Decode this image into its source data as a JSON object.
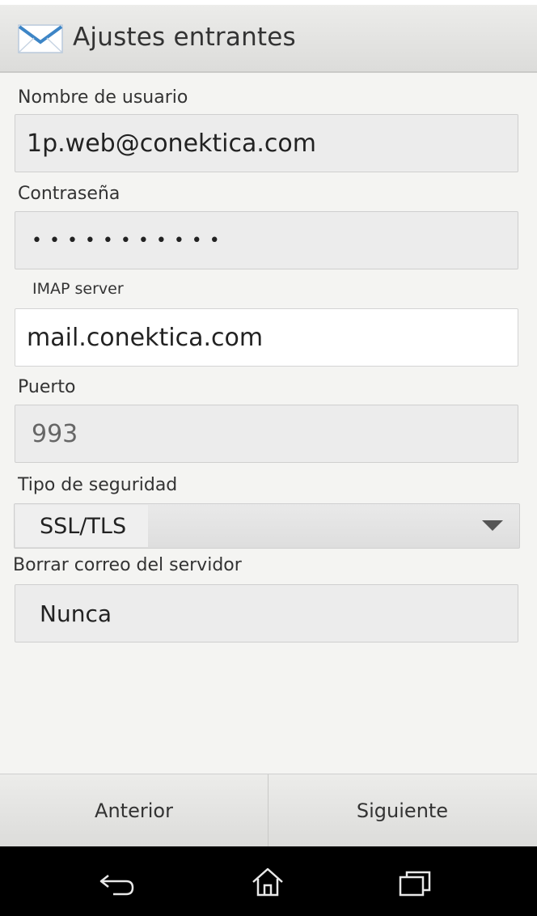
{
  "appbar": {
    "title": "Ajustes entrantes",
    "icon": "mail-envelope-icon"
  },
  "fields": {
    "username": {
      "label": "Nombre de usuario",
      "value": "1p.web@conektica.com"
    },
    "password": {
      "label": "Contraseña",
      "value": "•••••••••••"
    },
    "imap": {
      "label": "IMAP server",
      "value": "mail.conektica.com"
    },
    "port": {
      "label": "Puerto",
      "value": "993"
    },
    "security": {
      "label": "Tipo de seguridad",
      "value": "SSL/TLS"
    },
    "delete_mail": {
      "label": "Borrar correo del servidor",
      "value": "Nunca"
    }
  },
  "buttons": {
    "previous": "Anterior",
    "next": "Siguiente"
  },
  "navbar": {
    "icons": [
      "back-icon",
      "home-icon",
      "recent-apps-icon"
    ]
  },
  "colors": {
    "accent_mail": "#3d85c6",
    "background": "#f4f4f2",
    "navbar": "#000000"
  }
}
